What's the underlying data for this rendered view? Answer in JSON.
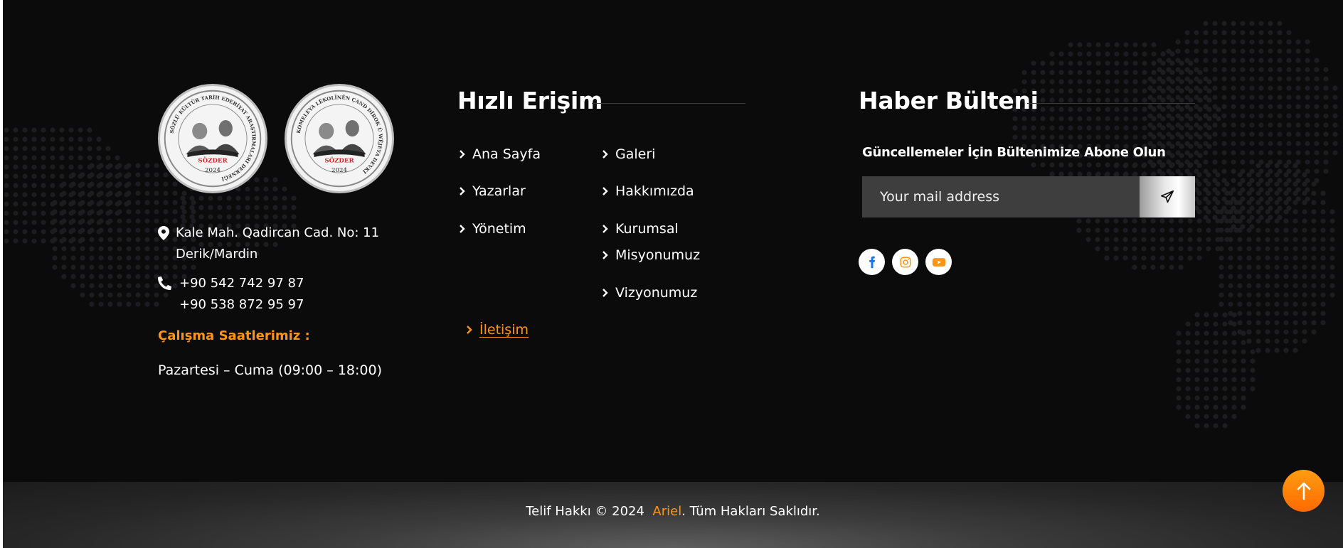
{
  "logos": {
    "left": {
      "ring_text": "SÖZLÜ KÜLTÜR TARİH EDEBİYAT ARAŞTIRMALARI DERNEĞİ",
      "name": "SÖZDER",
      "year": "2024"
    },
    "right": {
      "ring_text": "KOMELEYA LÊKOLÎNÊN ÇAND DÎROK Û WÊJEYA DEVKÎ",
      "name": "SÖZDER",
      "year": "2024"
    }
  },
  "contact": {
    "address_line1": "Kale Mah. Qadircan Cad. No: 11",
    "address_line2": "Derik/Mardin",
    "phone1": "+90 542 742 97 87",
    "phone2": "+90 538 872 95 97",
    "hours_title": "Çalışma Saatlerimiz :",
    "hours_text": "Pazartesi – Cuma (09:00 – 18:00)"
  },
  "quick_access": {
    "title": "Hızlı Erişim",
    "links": {
      "home": "Ana Sayfa",
      "gallery": "Galeri",
      "authors": "Yazarlar",
      "about": "Hakkımızda",
      "management": "Yönetim",
      "corporate": "Kurumsal",
      "mission": "Misyonumuz",
      "vision": "Vizyonumuz",
      "contact": "İletişim"
    }
  },
  "newsletter": {
    "title": "Haber Bülteni",
    "subtitle": "Güncellemeler İçin Bültenimize Abone Olun",
    "placeholder": "Your mail address",
    "send_icon": "paper-plane-icon"
  },
  "social": [
    "facebook-icon",
    "instagram-icon",
    "youtube-icon"
  ],
  "footer": {
    "prefix": "Telif Hakkı © 2024",
    "brand": "Ariel",
    "suffix": ". Tüm Hakları Saklıdır."
  },
  "colors": {
    "accent": "#ff9417",
    "background": "#0b0b0c",
    "facebook": "#1877f2"
  }
}
